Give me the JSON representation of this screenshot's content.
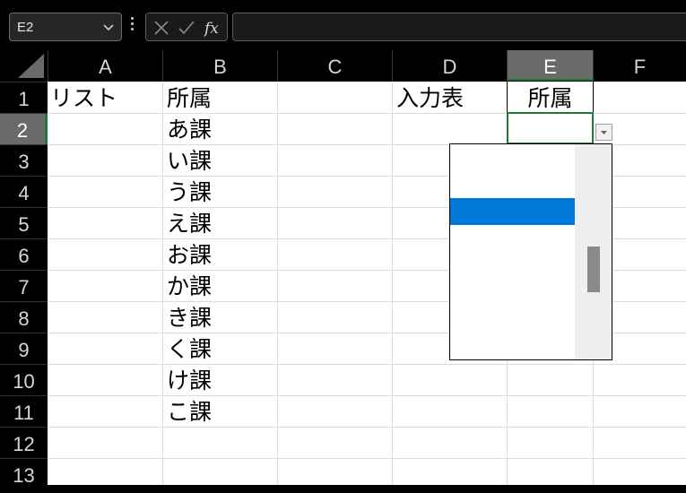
{
  "formula_bar": {
    "name_box": "E2",
    "formula": ""
  },
  "columns": [
    "A",
    "B",
    "C",
    "D",
    "E",
    "F"
  ],
  "selected_column": "E",
  "rows": [
    "1",
    "2",
    "3",
    "4",
    "5",
    "6",
    "7",
    "8",
    "9",
    "10",
    "11",
    "12",
    "13"
  ],
  "selected_row": "2",
  "cells": {
    "A1": "リスト",
    "B1": "所属",
    "B2": "あ課",
    "B3": "い課",
    "B4": "う課",
    "B5": "え課",
    "B6": "お課",
    "B7": "か課",
    "B8": "き課",
    "B9": "く課",
    "B10": "け課",
    "B11": "こ課",
    "D1": "入力表",
    "E1": "所属",
    "E2": ""
  },
  "dropdown": {
    "open": true,
    "highlighted_index": 2,
    "scroll_position": 0.55
  },
  "colors": {
    "selection_green": "#1f7a3a",
    "highlight_blue": "#0078d7"
  }
}
